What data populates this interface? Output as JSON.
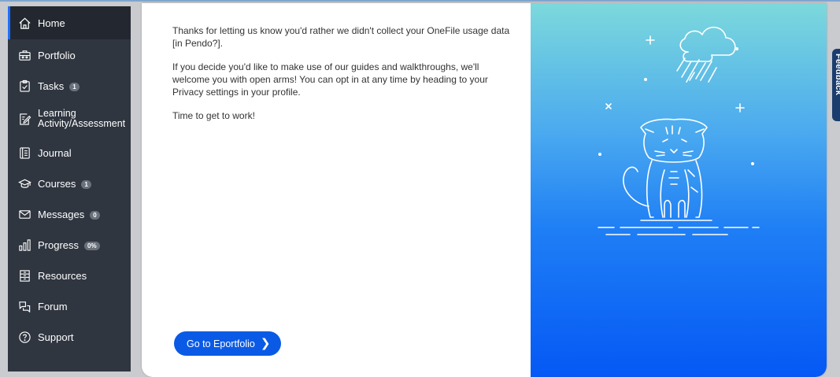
{
  "sidebar": {
    "items": [
      {
        "label": "Home",
        "icon": "home-icon",
        "active": true
      },
      {
        "label": "Portfolio",
        "icon": "briefcase-icon"
      },
      {
        "label": "Tasks",
        "icon": "clipboard-check-icon",
        "badge": "1"
      },
      {
        "label": "Learning Activity/Assessment",
        "icon": "edit-document-icon"
      },
      {
        "label": "Journal",
        "icon": "notebook-icon"
      },
      {
        "label": "Courses",
        "icon": "graduation-cap-icon",
        "badge": "1"
      },
      {
        "label": "Messages",
        "icon": "envelope-icon",
        "badge": "0"
      },
      {
        "label": "Progress",
        "icon": "bar-chart-icon",
        "badge": "0%"
      },
      {
        "label": "Resources",
        "icon": "bookcase-icon"
      },
      {
        "label": "Forum",
        "icon": "chat-bubbles-icon"
      },
      {
        "label": "Support",
        "icon": "help-circle-icon"
      }
    ]
  },
  "modal": {
    "paragraph_1": "Thanks for letting us know you'd rather we didn't collect your OneFile usage data [in Pendo?].",
    "paragraph_2": "If you decide you'd like to make use of our guides and walkthroughs, we'll welcome you with open arms! You can opt in at any time by heading to your Privacy settings in your profile.",
    "paragraph_3": "Time to get to work!",
    "cta_label": "Go to Eportfolio",
    "cta_icon": "chevron-right-icon"
  },
  "illustration": {
    "subject": "sad-cat-in-rain",
    "gradient_top": "#7cd9dc",
    "gradient_bottom": "#0558f5"
  },
  "side_tab": {
    "label": "Feedback"
  },
  "colors": {
    "sidebar_bg": "#2f3640",
    "accent": "#0a5ae6"
  }
}
